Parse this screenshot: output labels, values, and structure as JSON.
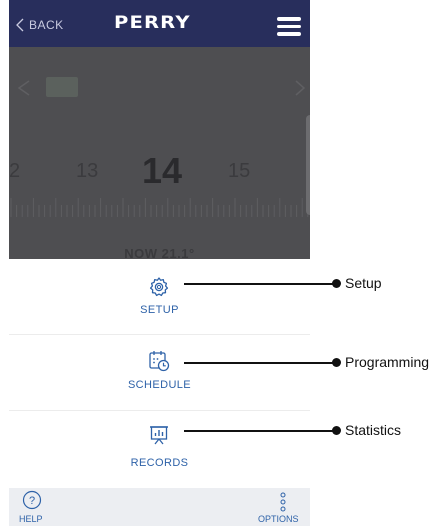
{
  "header": {
    "back_label": "BACK",
    "logo_text": "PERRY"
  },
  "calendar": {
    "days": [
      "2",
      "13",
      "14",
      "15"
    ],
    "now_label": "NOW 21.1°"
  },
  "menu_items": [
    {
      "label": "SETUP",
      "icon": "gear-icon"
    },
    {
      "label": "SCHEDULE",
      "icon": "calendar-clock-icon"
    },
    {
      "label": "RECORDS",
      "icon": "chart-board-icon"
    }
  ],
  "bottom": {
    "help_label": "HELP",
    "options_label": "OPTIONS"
  },
  "callouts": [
    "Setup",
    "Programming",
    "Statistics"
  ],
  "colors": {
    "header_bg": "#282e5c",
    "accent_blue": "#2e62a8",
    "overlay": "#4e4e51"
  }
}
